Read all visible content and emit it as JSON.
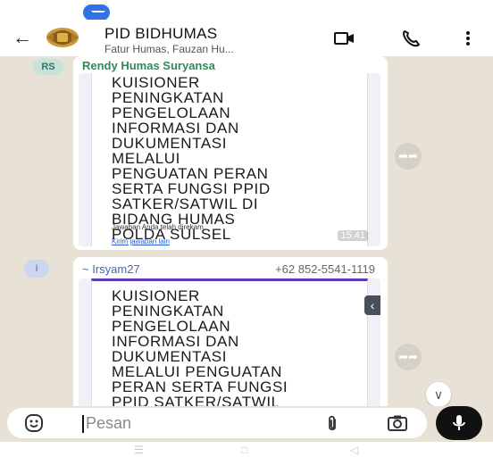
{
  "header": {
    "title": "PID BIDHUMAS",
    "subtitle": "Fatur Humas, Fauzan Hu..."
  },
  "messages": [
    {
      "avatar_initials": "RS",
      "sender": "Rendy Humas Suryansa",
      "document_text": "KUISIONER\nPENINGKATAN\nPENGELOLAAN\nINFORMASI DAN\nDUKUMENTASI\nMELALUI\nPENGUATAN PERAN\nSERTA FUNGSI PPID\nSATKER/SATWIL DI\nBIDANG HUMAS\nPOLDA SULSEL",
      "note": "Jawaban Anda telah direkam.",
      "link": "Kirim jawaban lain",
      "time": "15.41"
    },
    {
      "avatar_initials": "I",
      "sender": "~ Irsyam27",
      "phone": "+62 852-5541-1119",
      "document_text": "KUISIONER\nPENINGKATAN\nPENGELOLAAN\nINFORMASI DAN\nDUKUMENTASI\nMELALUI PENGUATAN\nPERAN SERTA FUNGSI\nPPID SATKER/SATWIL\nDI BIDANG HUMAS\nPOLDA SULSEL"
    }
  ],
  "input": {
    "placeholder": "Pesan"
  },
  "colors": {
    "chat_bg": "#e8e1d6",
    "sender1": "#2c8a5a",
    "sender2": "#4a63b8",
    "accent_form": "#5e3bb5"
  },
  "icons": [
    "back-arrow-icon",
    "video-call-icon",
    "voice-call-icon",
    "more-options-icon",
    "forward-icon",
    "scroll-down-icon",
    "emoji-icon",
    "attach-icon",
    "camera-icon",
    "mic-icon"
  ]
}
